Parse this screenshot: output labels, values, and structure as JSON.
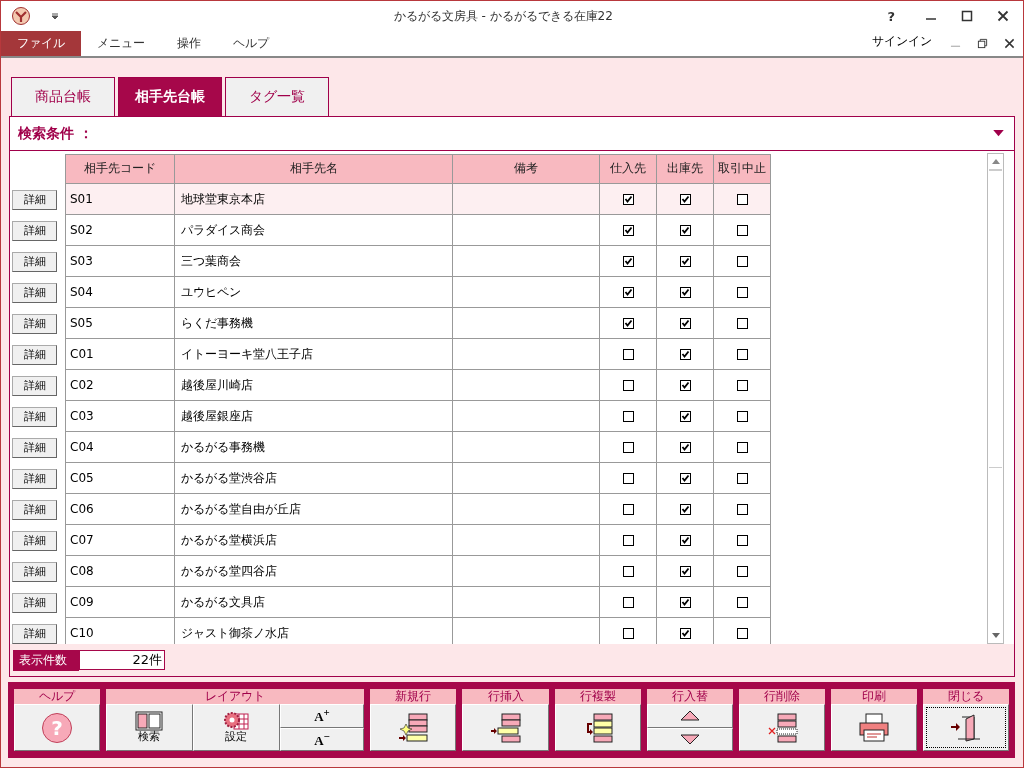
{
  "window": {
    "title": "かるがる文房具 - かるがるできる在庫22",
    "help": "?",
    "signin": "サインイン"
  },
  "menu": [
    {
      "label": "ファイル",
      "selected": true
    },
    {
      "label": "メニュー",
      "selected": false
    },
    {
      "label": "操作",
      "selected": false
    },
    {
      "label": "ヘルプ",
      "selected": false
    }
  ],
  "tabs": [
    {
      "label": "商品台帳",
      "selected": false
    },
    {
      "label": "相手先台帳",
      "selected": true
    },
    {
      "label": "タグ一覧",
      "selected": false
    }
  ],
  "search": {
    "label": "検索条件 ："
  },
  "table": {
    "columns": [
      "相手先コード",
      "相手先名",
      "備考",
      "仕入先",
      "出庫先",
      "取引中止"
    ],
    "rows": [
      {
        "detail": "詳細",
        "code": "S01",
        "name": "地球堂東京本店",
        "note": "",
        "supplier": true,
        "shipto": true,
        "suspended": false,
        "selected": true
      },
      {
        "detail": "詳細",
        "code": "S02",
        "name": "パラダイス商会",
        "note": "",
        "supplier": true,
        "shipto": true,
        "suspended": false,
        "selected": false
      },
      {
        "detail": "詳細",
        "code": "S03",
        "name": "三つ葉商会",
        "note": "",
        "supplier": true,
        "shipto": true,
        "suspended": false,
        "selected": false
      },
      {
        "detail": "詳細",
        "code": "S04",
        "name": "ユウヒペン",
        "note": "",
        "supplier": true,
        "shipto": true,
        "suspended": false,
        "selected": false
      },
      {
        "detail": "詳細",
        "code": "S05",
        "name": "らくだ事務機",
        "note": "",
        "supplier": true,
        "shipto": true,
        "suspended": false,
        "selected": false
      },
      {
        "detail": "詳細",
        "code": "C01",
        "name": "イトーヨーキ堂八王子店",
        "note": "",
        "supplier": false,
        "shipto": true,
        "suspended": false,
        "selected": false
      },
      {
        "detail": "詳細",
        "code": "C02",
        "name": "越後屋川崎店",
        "note": "",
        "supplier": false,
        "shipto": true,
        "suspended": false,
        "selected": false
      },
      {
        "detail": "詳細",
        "code": "C03",
        "name": "越後屋銀座店",
        "note": "",
        "supplier": false,
        "shipto": true,
        "suspended": false,
        "selected": false
      },
      {
        "detail": "詳細",
        "code": "C04",
        "name": "かるがる事務機",
        "note": "",
        "supplier": false,
        "shipto": true,
        "suspended": false,
        "selected": false
      },
      {
        "detail": "詳細",
        "code": "C05",
        "name": "かるがる堂渋谷店",
        "note": "",
        "supplier": false,
        "shipto": true,
        "suspended": false,
        "selected": false
      },
      {
        "detail": "詳細",
        "code": "C06",
        "name": "かるがる堂自由が丘店",
        "note": "",
        "supplier": false,
        "shipto": true,
        "suspended": false,
        "selected": false
      },
      {
        "detail": "詳細",
        "code": "C07",
        "name": "かるがる堂横浜店",
        "note": "",
        "supplier": false,
        "shipto": true,
        "suspended": false,
        "selected": false
      },
      {
        "detail": "詳細",
        "code": "C08",
        "name": "かるがる堂四谷店",
        "note": "",
        "supplier": false,
        "shipto": true,
        "suspended": false,
        "selected": false
      },
      {
        "detail": "詳細",
        "code": "C09",
        "name": "かるがる文具店",
        "note": "",
        "supplier": false,
        "shipto": true,
        "suspended": false,
        "selected": false
      },
      {
        "detail": "詳細",
        "code": "C10",
        "name": "ジャスト御茶ノ水店",
        "note": "",
        "supplier": false,
        "shipto": true,
        "suspended": false,
        "selected": false
      }
    ]
  },
  "count": {
    "label": "表示件数",
    "value": "22件"
  },
  "toolbar": [
    {
      "label": "ヘルプ",
      "buttons": [
        {
          "kind": "help",
          "glyph": "?"
        }
      ]
    },
    {
      "label": "レイアウト",
      "buttons": [
        {
          "kind": "layout",
          "label": "検索"
        },
        {
          "kind": "settings",
          "label": "設定"
        },
        {
          "kind": "font",
          "labels": [
            "A$^{+}$",
            "A$^{−}$"
          ]
        }
      ]
    },
    {
      "label": "新規行",
      "buttons": [
        {
          "kind": "new-row"
        }
      ]
    },
    {
      "label": "行挿入",
      "buttons": [
        {
          "kind": "insert-row"
        }
      ]
    },
    {
      "label": "行複製",
      "buttons": [
        {
          "kind": "copy-row"
        }
      ]
    },
    {
      "label": "行入替",
      "buttons": [
        {
          "kind": "swap"
        }
      ]
    },
    {
      "label": "行削除",
      "buttons": [
        {
          "kind": "delete-row"
        }
      ]
    },
    {
      "label": "印刷",
      "buttons": [
        {
          "kind": "print"
        }
      ]
    },
    {
      "label": "閉じる",
      "buttons": [
        {
          "kind": "close"
        }
      ]
    }
  ]
}
